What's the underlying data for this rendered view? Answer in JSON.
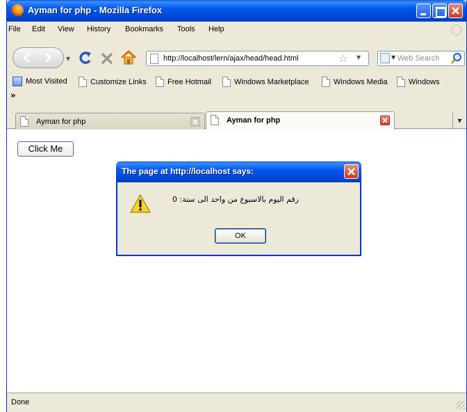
{
  "window": {
    "title": "Ayman for php - Mozilla Firefox"
  },
  "menubar": {
    "items": [
      "File",
      "Edit",
      "View",
      "History",
      "Bookmarks",
      "Tools",
      "Help"
    ]
  },
  "navbar": {
    "url": "http://localhost/lern/ajax/head/head.html",
    "search_placeholder": "Web Search"
  },
  "bookmarks": {
    "items": [
      "Most Visited",
      "Customize Links",
      "Free Hotmail",
      "Windows Marketplace",
      "Windows Media",
      "Windows"
    ],
    "overflow": "»"
  },
  "tabs": [
    {
      "label": "Ayman for php",
      "selected": false
    },
    {
      "label": "Ayman for php",
      "selected": true
    }
  ],
  "content": {
    "button_label": "Click Me"
  },
  "dialog": {
    "title": "The page at http://localhost says:",
    "message": "رقم اليوم بالاسبوع من واحد الى ستة: 0",
    "ok_label": "OK"
  },
  "status": {
    "text": "Done"
  },
  "colors": {
    "titlebar": "#0058ee",
    "window_frame": "#ece9d8",
    "close_button": "#c8391b"
  }
}
